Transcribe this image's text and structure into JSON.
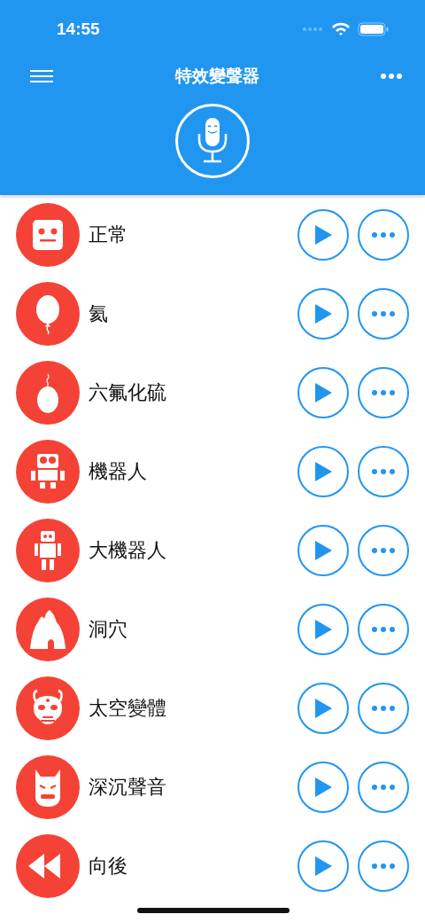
{
  "status_bar": {
    "time": "14:55"
  },
  "header": {
    "title": "特效變聲器"
  },
  "effects": [
    {
      "name": "正常",
      "kind": "face"
    },
    {
      "name": "氦",
      "kind": "balloon"
    },
    {
      "name": "六氟化硫",
      "kind": "heavy-balloon"
    },
    {
      "name": "機器人",
      "kind": "robot"
    },
    {
      "name": "大機器人",
      "kind": "big-robot"
    },
    {
      "name": "洞穴",
      "kind": "cave"
    },
    {
      "name": "太空變體",
      "kind": "alien"
    },
    {
      "name": "深沉聲音",
      "kind": "mask"
    },
    {
      "name": "向後",
      "kind": "rewind"
    }
  ]
}
